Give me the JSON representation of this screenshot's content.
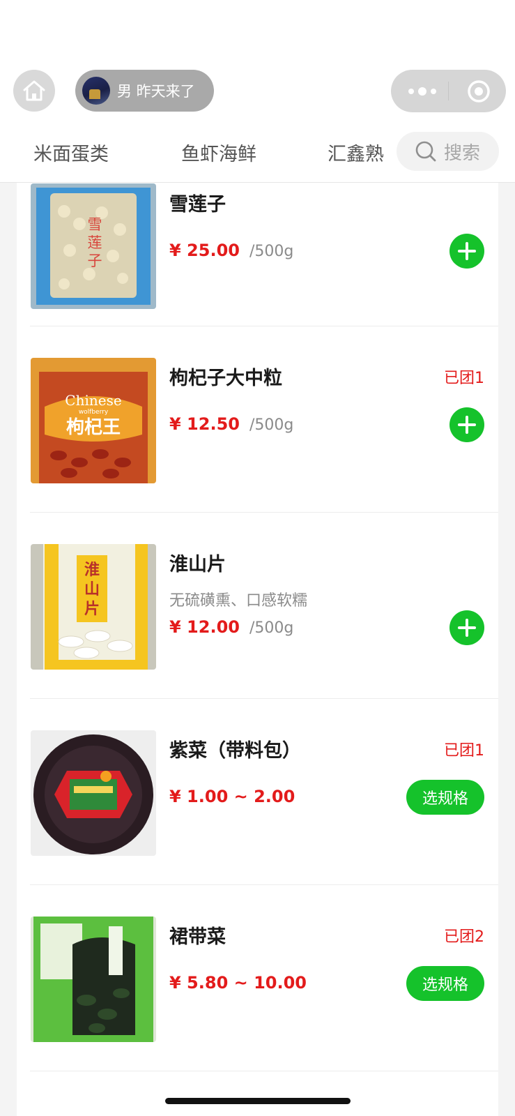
{
  "header": {
    "user_label": "男 昨天来了",
    "tabs": [
      {
        "label": "米面蛋类"
      },
      {
        "label": "鱼虾海鲜"
      },
      {
        "label": "汇鑫熟"
      }
    ],
    "search_label": "搜索"
  },
  "products": [
    {
      "name": "雪莲子",
      "sold": "",
      "desc": "",
      "price": "¥ 25.00",
      "unit": "/500g",
      "action": "add",
      "image_text": "雪莲子"
    },
    {
      "name": "枸杞子大中粒",
      "sold": "已团1",
      "desc": "",
      "price": "¥ 12.50",
      "unit": "/500g",
      "action": "add",
      "image_text": "Chinese wolfberry 枸杞王"
    },
    {
      "name": "淮山片",
      "sold": "",
      "desc": "无硫磺熏、口感软糯",
      "price": "¥ 12.00",
      "unit": "/500g",
      "action": "add",
      "image_text": "淮山片"
    },
    {
      "name": "紫菜（带料包）",
      "sold": "已团1",
      "desc": "",
      "price": "¥ 1.00 ~ 2.00",
      "unit": "",
      "action": "spec",
      "spec_label": "选规格"
    },
    {
      "name": "裙带菜",
      "sold": "已团2",
      "desc": "",
      "price": "¥ 5.80 ~ 10.00",
      "unit": "",
      "action": "spec",
      "spec_label": "选规格"
    }
  ],
  "colors": {
    "accent_green": "#15c22b",
    "price_red": "#e31b1b",
    "muted_gray": "#8a8a8a"
  },
  "icons": [
    "home-icon",
    "more-dots-icon",
    "capsule-close-icon",
    "search-icon",
    "plus-icon"
  ]
}
